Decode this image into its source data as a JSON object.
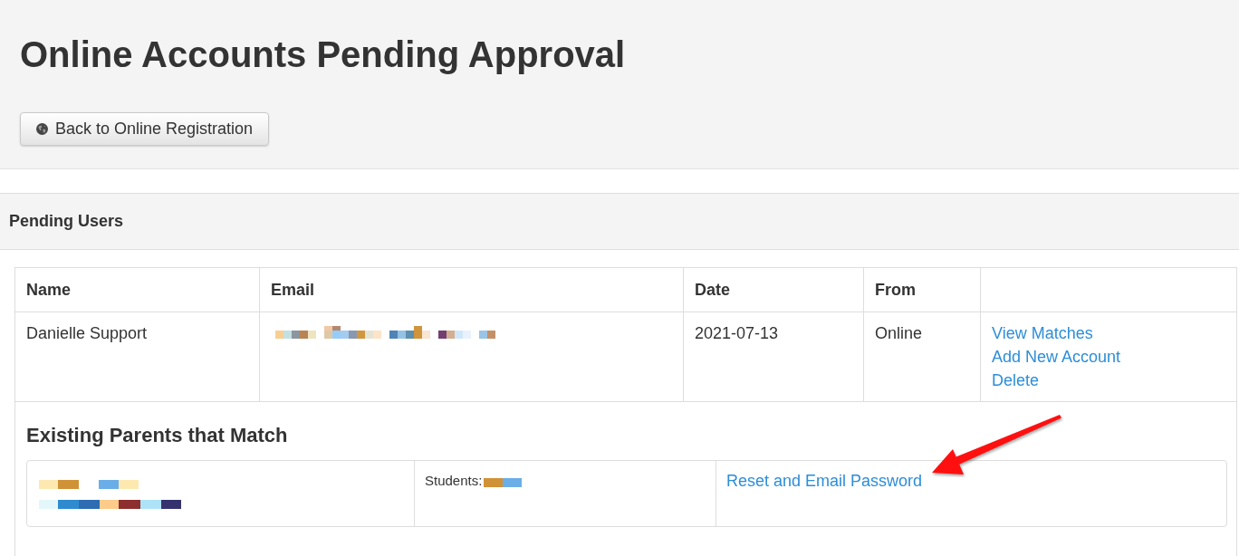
{
  "page": {
    "title": "Online Accounts Pending Approval",
    "back_button": {
      "label": "Back to Online Registration"
    }
  },
  "panel": {
    "heading": "Pending Users",
    "table": {
      "columns": [
        "Name",
        "Email",
        "Date",
        "From"
      ],
      "rows": [
        {
          "name": "Danielle Support",
          "email_redacted": true,
          "date": "2021-07-13",
          "from": "Online",
          "actions": [
            "View Matches",
            "Add New Account",
            "Delete"
          ]
        }
      ]
    },
    "matches": {
      "heading": "Existing Parents that Match",
      "rows": [
        {
          "parent_redacted": true,
          "students_label": "Students:",
          "students_redacted": true,
          "action": "Reset and Email Password"
        }
      ]
    }
  }
}
